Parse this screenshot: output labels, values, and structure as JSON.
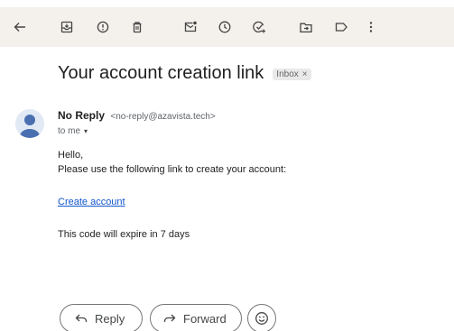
{
  "toolbar": {
    "icons": [
      "back-arrow-icon",
      "archive-icon",
      "report-spam-icon",
      "delete-icon",
      "mark-unread-icon",
      "snooze-icon",
      "add-to-tasks-icon",
      "move-to-icon",
      "label-icon",
      "more-options-icon"
    ]
  },
  "email": {
    "subject": "Your account creation link",
    "label": "Inbox",
    "label_remove": "×",
    "sender_name": "No Reply",
    "sender_email": "<no-reply@azavista.tech>",
    "to": "to me",
    "to_caret": "▾",
    "greeting": "Hello,",
    "body_line": "Please use the following link to create your account:",
    "link_text": "Create account",
    "expire_text": "This code will expire in 7 days"
  },
  "actions": {
    "reply_label": "Reply",
    "forward_label": "Forward"
  },
  "colors": {
    "toolbar_bg": "#f4f1ec",
    "link": "#1155cc",
    "avatar_bg": "#e1e9f5",
    "avatar_fg": "#4a6fb0"
  }
}
